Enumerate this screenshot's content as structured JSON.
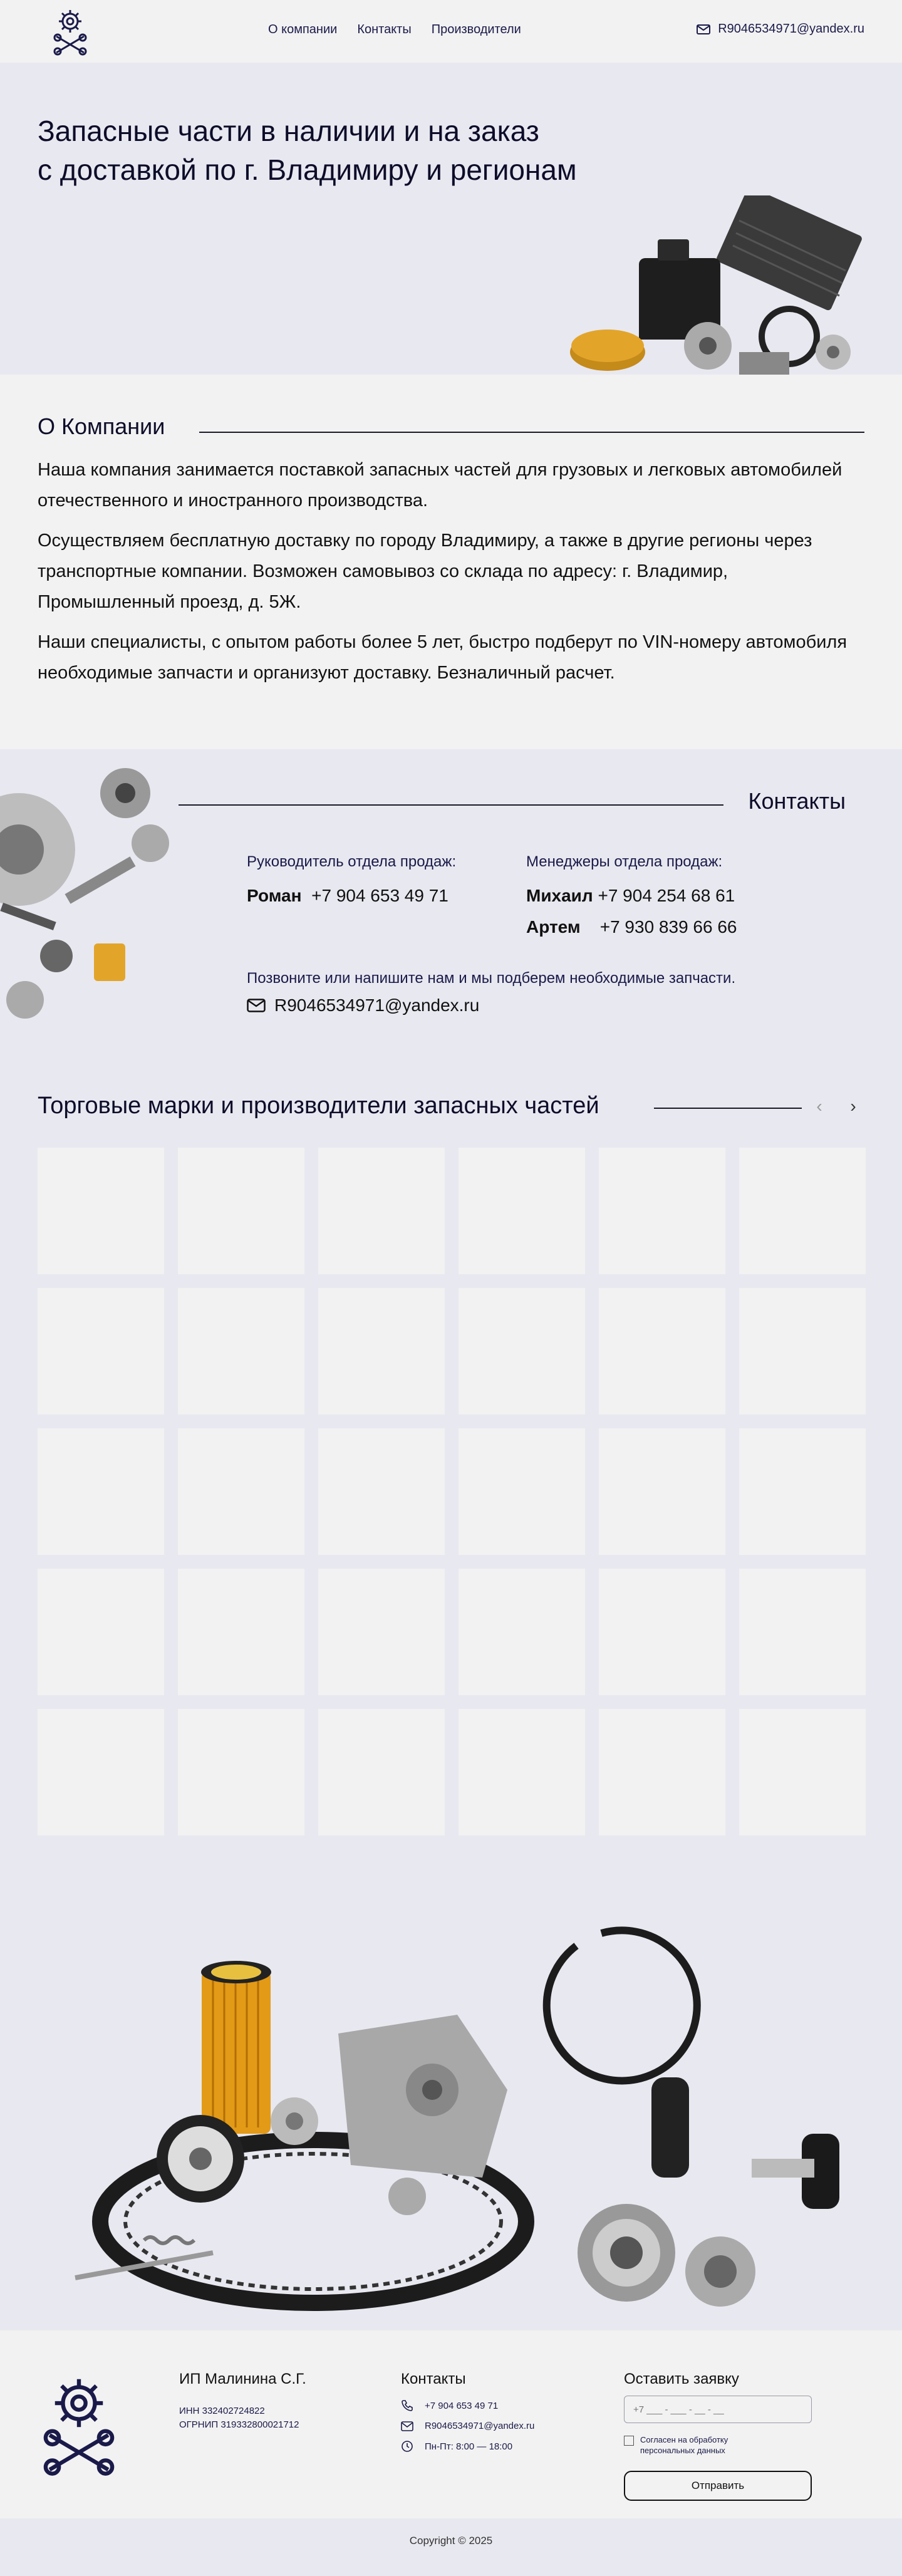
{
  "header": {
    "nav": [
      "О компании",
      "Контакты",
      "Производители"
    ],
    "email": "R9046534971@yandex.ru"
  },
  "hero": {
    "title_line1": "Запасные части в наличии и на заказ",
    "title_line2": "с доставкой по г. Владимиру и регионам"
  },
  "about": {
    "title": "О Компании",
    "paragraphs": [
      "Наша компания занимается поставкой запасных частей для грузовых и легковых автомобилей отечественного и иностранного производства.",
      "Осуществляем бесплатную доставку по городу Владимиру, а также в другие регионы через транспортные компании. Возможен самовывоз со склада по адресу: г. Владимир, Промышленный проезд, д. 5Ж.",
      "Наши специалисты, с опытом работы более 5 лет, быстро подберут по VIN-номеру автомобиля необходимые запчасти и организуют доставку. Безналичный расчет."
    ]
  },
  "contacts": {
    "title": "Контакты",
    "head_label": "Руководитель отдела продаж:",
    "head_name": "Роман",
    "head_phone": "+7 904 653 49 71",
    "managers_label": "Менеджеры отдела продаж:",
    "manager1_name": "Михаил",
    "manager1_phone": "+7 904 254 68 61",
    "manager2_name": "Артем",
    "manager2_phone": "+7 930 839 66 66",
    "note": "Позвоните или напишите нам и мы подберем необходимые запчасти.",
    "email": "R9046534971@yandex.ru"
  },
  "brands": {
    "title": "Торговые марки и производители запасных частей",
    "prev": "‹",
    "next": "›"
  },
  "footer": {
    "company_name": "ИП Малинина С.Г.",
    "inn": "ИНН 332402724822",
    "ogrnip": "ОГРНИП 319332800021712",
    "contacts_title": "Контакты",
    "phone": "+7 904 653 49 71",
    "email": "R9046534971@yandex.ru",
    "hours": "Пн-Пт: 8:00 — 18:00",
    "form_title": "Оставить заявку",
    "phone_placeholder": "+7 ___ - ___ - __ - __",
    "consent": "Согласен на обработку персональных данных",
    "submit": "Отправить",
    "copyright": "Copyright © 2025"
  },
  "colors": {
    "accent": "#1a1a4a",
    "background": "#e8e8f0",
    "panel": "#f2f2f2"
  }
}
